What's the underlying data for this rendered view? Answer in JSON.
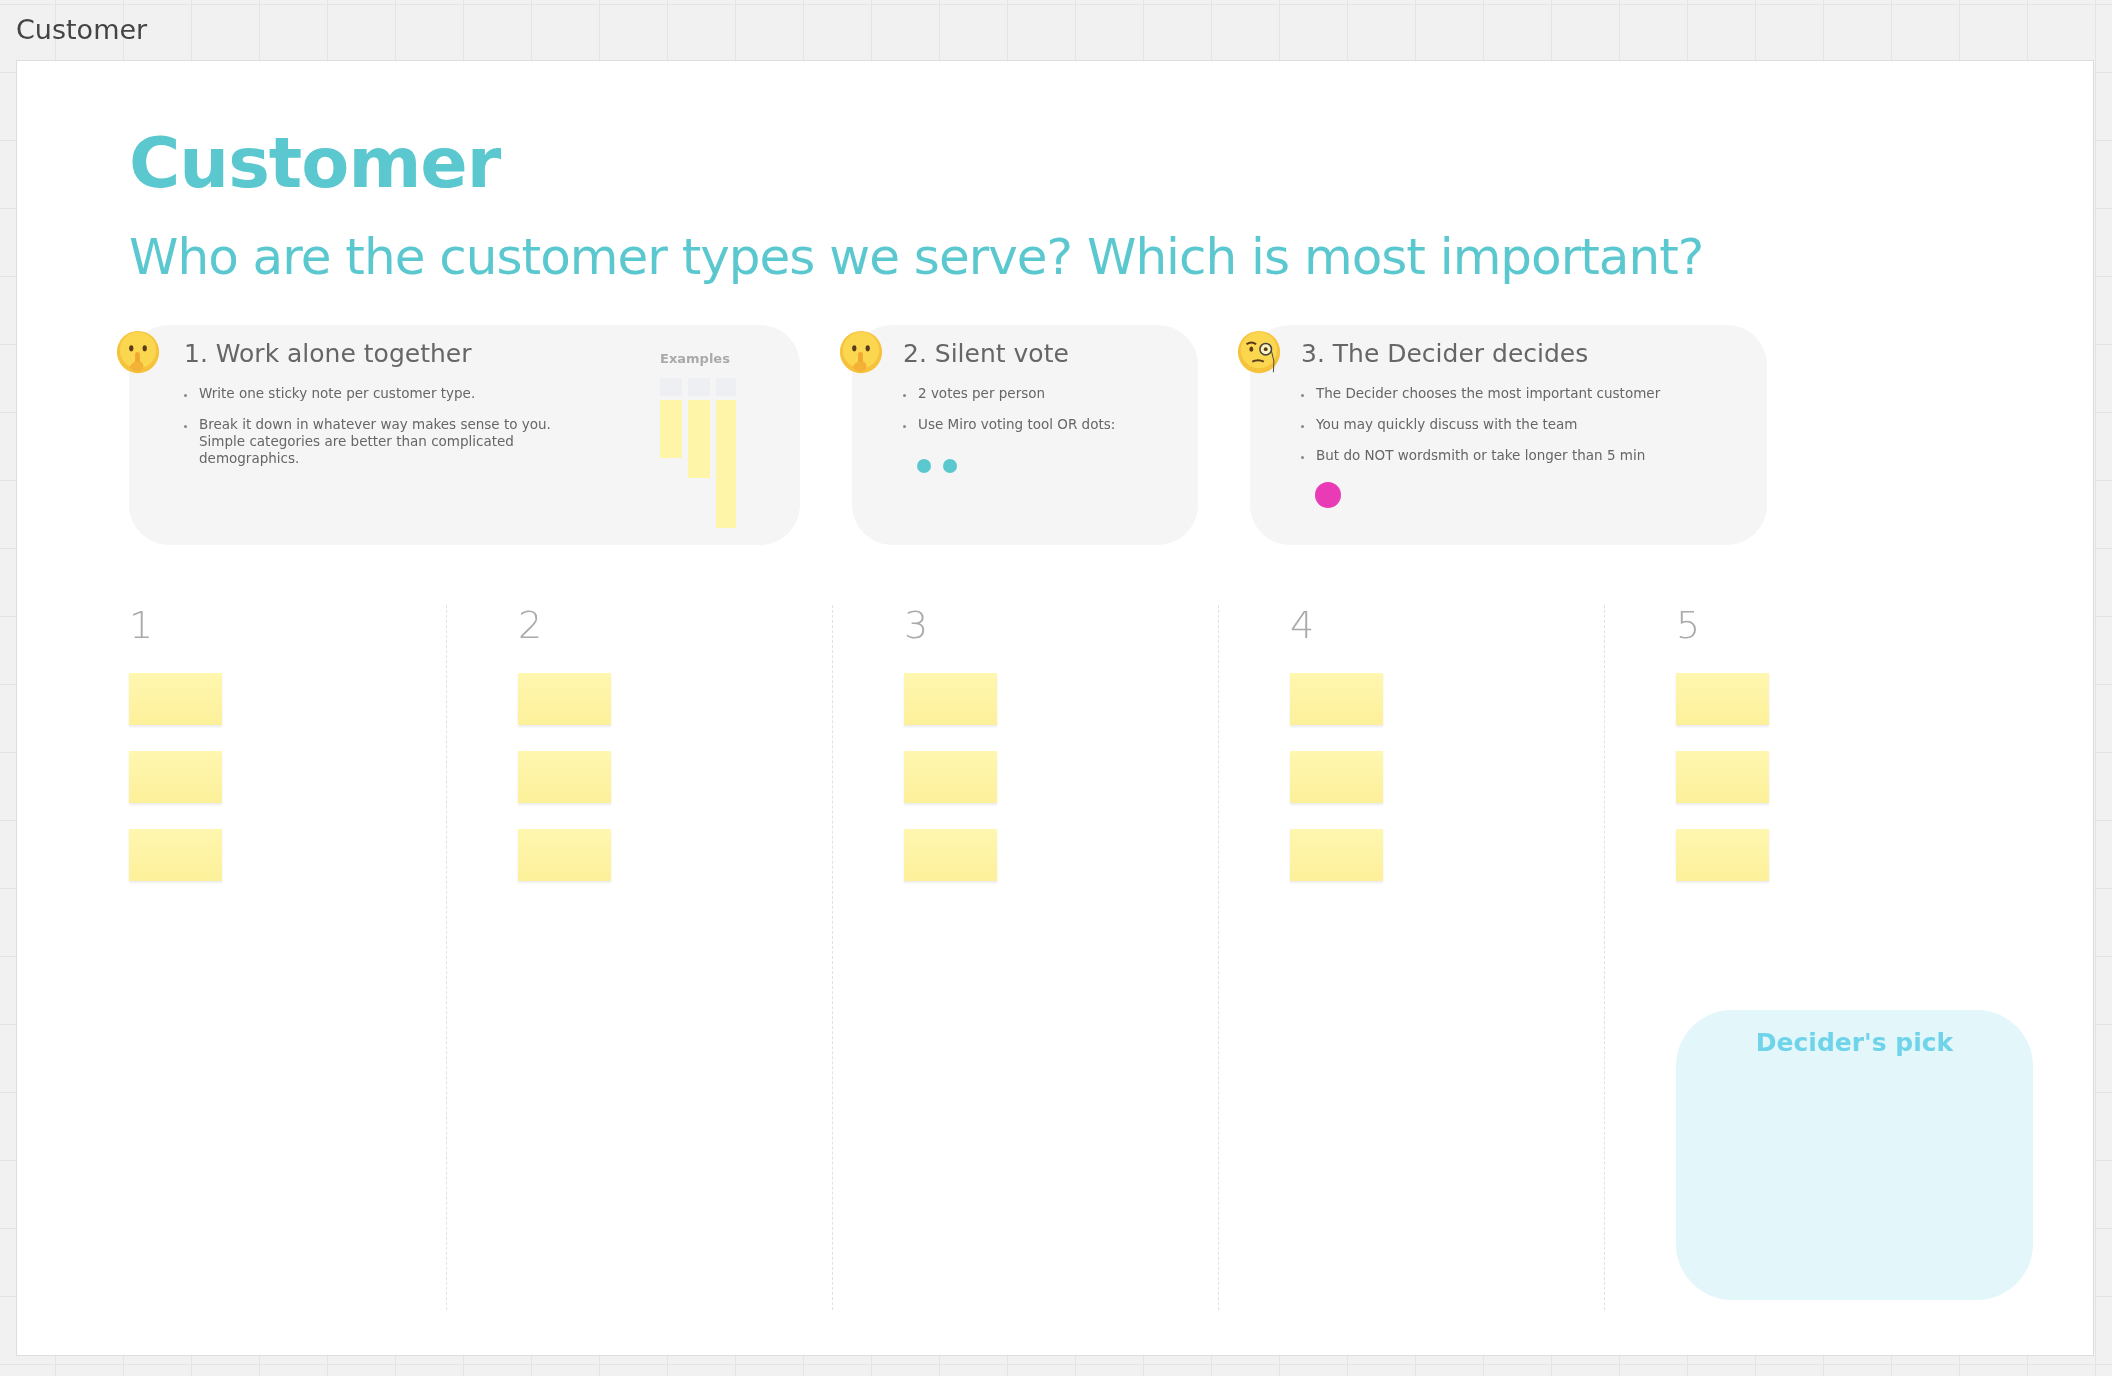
{
  "frame": {
    "label": "Customer"
  },
  "title": "Customer",
  "subtitle": "Who are the customer types we serve? Which is most important?",
  "cards": [
    {
      "kind": "examples",
      "emoji": {
        "kind": "shush"
      },
      "heading": "1. Work alone together",
      "bullets": [
        "Write one sticky note per customer type.",
        "Break it down in whatever way makes sense to you. Simple categories are better than complicated demographics."
      ],
      "examples_label": "Examples"
    },
    {
      "kind": "dots",
      "emoji": {
        "kind": "shush"
      },
      "heading": "2. Silent vote",
      "bullets": [
        "2 votes per person",
        "Use Miro voting tool OR dots:"
      ],
      "dots": [
        {
          "color": "#5bc8d0"
        },
        {
          "color": "#5bc8d0"
        }
      ]
    },
    {
      "kind": "dots",
      "emoji": {
        "kind": "monocle"
      },
      "heading": "3. The Decider decides",
      "bullets": [
        "The Decider chooses the most important customer",
        "You may quickly discuss with the team",
        "But do NOT wordsmith or take longer than 5 min"
      ],
      "dots": [
        {
          "color": "#e83bb5"
        }
      ]
    }
  ],
  "columns": [
    {
      "label": "1",
      "notes": [
        {
          "kind": "sticky"
        },
        {
          "kind": "sticky"
        },
        {
          "kind": "sticky"
        }
      ]
    },
    {
      "label": "2",
      "notes": [
        {
          "kind": "sticky"
        },
        {
          "kind": "sticky"
        },
        {
          "kind": "sticky"
        }
      ]
    },
    {
      "label": "3",
      "notes": [
        {
          "kind": "sticky"
        },
        {
          "kind": "sticky"
        },
        {
          "kind": "sticky"
        }
      ]
    },
    {
      "label": "4",
      "notes": [
        {
          "kind": "sticky"
        },
        {
          "kind": "sticky"
        },
        {
          "kind": "sticky"
        }
      ]
    },
    {
      "label": "5",
      "notes": [
        {
          "kind": "sticky"
        },
        {
          "kind": "sticky"
        },
        {
          "kind": "sticky"
        }
      ]
    }
  ],
  "decider_pick": {
    "label": "Decider's pick"
  }
}
